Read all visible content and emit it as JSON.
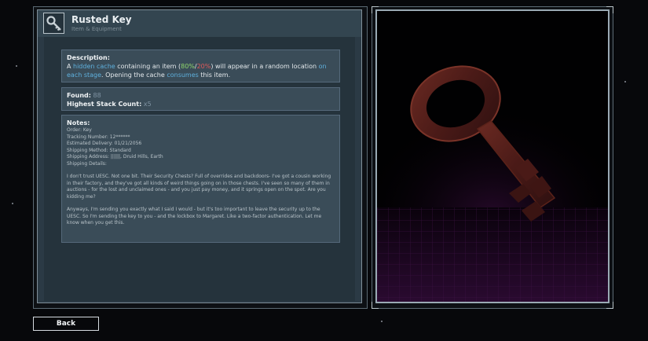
{
  "item": {
    "title": "Rusted Key",
    "subtitle": "Item & Equipment"
  },
  "description": {
    "label": "Description:",
    "p1": "A ",
    "p2": "hidden cache",
    "p3": " containing an item (",
    "p4": "80%",
    "p5": "/",
    "p6": "20%",
    "p7": ") will appear in a random location ",
    "p8": "on each stage",
    "p9": ". Opening the cache ",
    "p10": "consumes",
    "p11": " this item."
  },
  "stats": {
    "found_label": "Found:",
    "found_value": "88",
    "stack_label": "Highest Stack Count:",
    "stack_value": "x5"
  },
  "notes": {
    "label": "Notes:",
    "lines": [
      "Order: Key",
      "Tracking Number: 12******",
      "Estimated Delivery: 01/21/2056",
      "Shipping Method: Standard",
      "Shipping Address: ||||||, Druid Hills, Earth",
      "Shipping Details:"
    ],
    "paragraph1": "I don't trust UESC. Not one bit. Their Security Chests? Full of overrides and backdoors- I've got a cousin working in their factory, and they've got all kinds of weird things going on in those chests. I've seen so many of them in auctions - for the lost and unclaimed ones - and you just pay money, and it springs open on the spot. Are you kidding me?",
    "paragraph2": "Anyways, I'm sending you exactly what I said I would - but it's too important to leave the security up to the UESC. So I'm sending the key to you - and the lockbox to Margaret. Like a two-factor authentication. Let me know when you get this."
  },
  "back_button": "Back",
  "icons": {
    "item": "key-icon"
  },
  "colors": {
    "highlight_blue": "#5fb0dd",
    "green": "#8ed46c",
    "red": "#e0595a",
    "panel": "#2b3a45"
  }
}
